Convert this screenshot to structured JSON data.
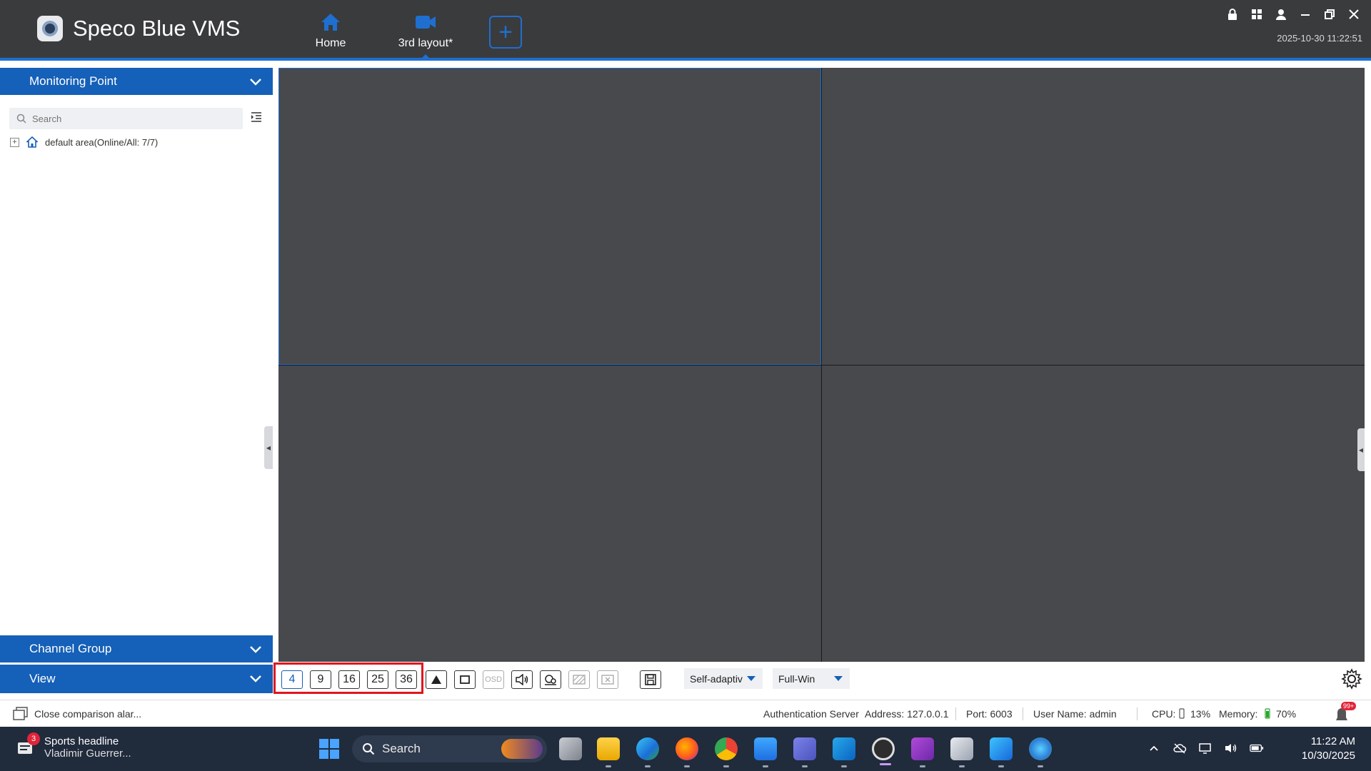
{
  "header": {
    "app_title": "Speco Blue VMS",
    "tabs": [
      {
        "label": "Home",
        "icon": "home-icon"
      },
      {
        "label": "3rd layout*",
        "icon": "camera-icon"
      }
    ],
    "add_tab_label": "+",
    "datetime": "2025-10-30 11:22:51",
    "window_controls": [
      "lock-icon",
      "grid-icon",
      "user-icon",
      "minimize-icon",
      "restore-icon",
      "close-icon"
    ]
  },
  "sidebar": {
    "monitoring_point": "Monitoring Point",
    "search_placeholder": "Search",
    "tree": [
      {
        "label": "default area(Online/All: 7/7)",
        "expander": "+"
      }
    ],
    "channel_group": "Channel Group",
    "view": "View"
  },
  "toolbar": {
    "split_buttons": [
      "4",
      "9",
      "16",
      "25",
      "36"
    ],
    "active_split": "4",
    "osd_label": "OSD",
    "stream_mode": "Self-adaptiv",
    "window_mode": "Full-Win"
  },
  "statusbar": {
    "message": "Close comparison alar...",
    "auth_server": "Authentication Server",
    "address": "Address: 127.0.0.1",
    "port": "Port: 6003",
    "user": "User Name: admin",
    "cpu_label": "CPU:",
    "cpu_value": "13%",
    "memory_label": "Memory:",
    "memory_value": "70%",
    "alarm_badge": "99+"
  },
  "taskbar": {
    "news_title": "Sports headline",
    "news_sub": "Vladimir Guerrer...",
    "news_badge": "3",
    "search_label": "Search",
    "time": "11:22 AM",
    "date": "10/30/2025"
  },
  "colors": {
    "accent": "#1560b8",
    "header_bg": "#3a3b3d",
    "video_bg": "#48494c",
    "highlight": "#e0161d",
    "taskbar_bg": "#202b3c"
  }
}
